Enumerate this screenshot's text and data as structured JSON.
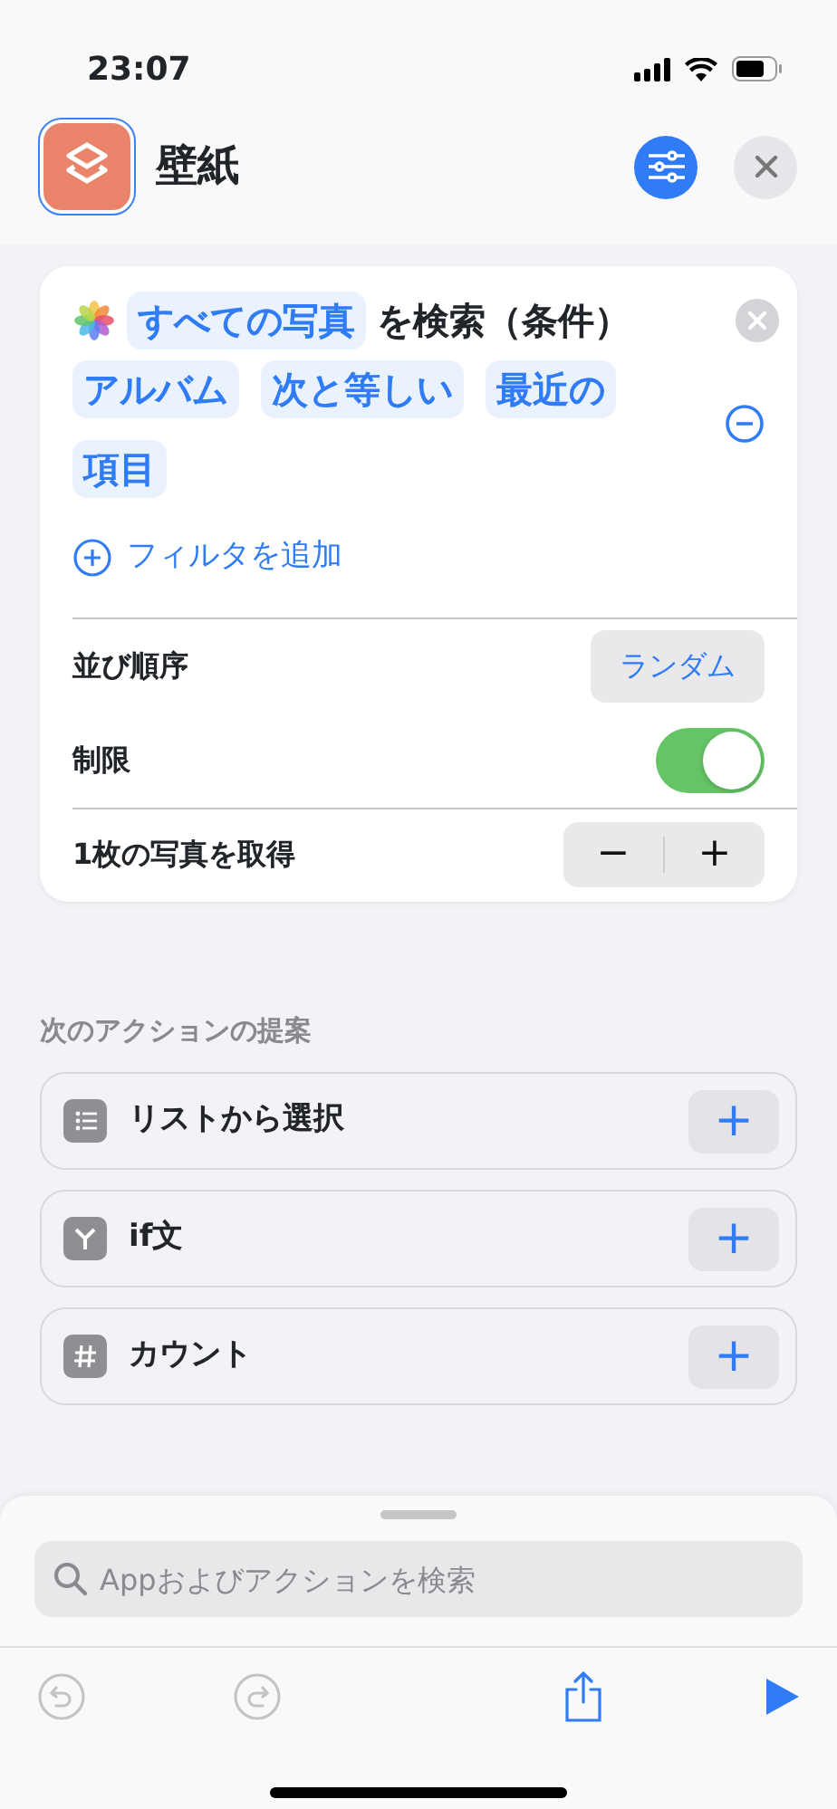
{
  "status_bar": {
    "time": "23:07"
  },
  "header": {
    "title": "壁紙"
  },
  "action": {
    "source": "すべての写真",
    "verb": "を検索（条件）",
    "filter": {
      "tokens": [
        {
          "lines": [
            "アルバム"
          ]
        },
        {
          "lines": [
            "次と等しい"
          ]
        },
        {
          "lines": [
            "最近の",
            "項目"
          ]
        }
      ]
    },
    "add_filter": "フィルタを追加",
    "rows": [
      {
        "kind": "select",
        "label": "並び順序",
        "value": "ランダム"
      },
      {
        "kind": "toggle",
        "label": "制限",
        "on": true
      },
      {
        "kind": "stepper",
        "label": "1枚の写真を取得",
        "minus": "−",
        "plus": "+"
      }
    ]
  },
  "suggestions": {
    "title": "次のアクションの提案",
    "items": [
      {
        "kind": "list",
        "label": "リストから選択",
        "add": "+"
      },
      {
        "kind": "branch",
        "label": "if文",
        "add": "+"
      },
      {
        "kind": "number",
        "label": "カウント",
        "add": "+"
      }
    ]
  },
  "search": {
    "placeholder": "Appおよびアクションを検索"
  },
  "toolbar": {
    "undo_disabled": true,
    "redo_disabled": true
  }
}
